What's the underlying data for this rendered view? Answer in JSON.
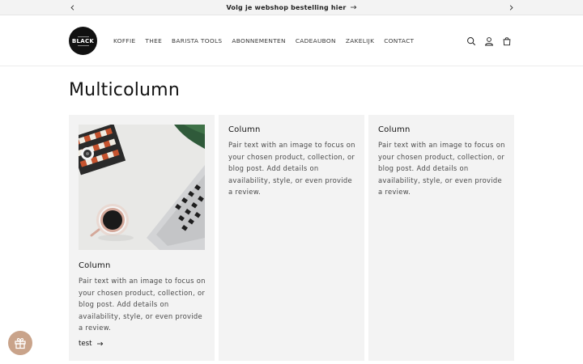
{
  "announcement": {
    "message": "Volg je webshop bestelling hier"
  },
  "header": {
    "logo_text": "BLACK",
    "nav": [
      {
        "label": "KOFFIE"
      },
      {
        "label": "THEE"
      },
      {
        "label": "BARISTA TOOLS"
      },
      {
        "label": "ABONNEMENTEN"
      },
      {
        "label": "CADEAUBON"
      },
      {
        "label": "ZAKELIJK"
      },
      {
        "label": "CONTACT"
      }
    ],
    "icons": [
      "search-icon",
      "account-icon",
      "cart-icon"
    ]
  },
  "main": {
    "title": "Multicolumn",
    "columns": [
      {
        "title": "Column",
        "text": "Pair text with an image to focus on your chosen product, collection, or blog post. Add details on availability, style, or even provide a review.",
        "link": "test",
        "has_image": true
      },
      {
        "title": "Column",
        "text": "Pair text with an image to focus on your chosen product, collection, or blog post. Add details on availability, style, or even provide a review."
      },
      {
        "title": "Column",
        "text": "Pair text with an image to focus on your chosen product, collection, or blog post. Add details on availability, style, or even provide a review."
      }
    ]
  },
  "floating": {
    "icon": "gift-icon",
    "color": "#c9a38a"
  },
  "colors": {
    "card_bg": "#f3f3f3",
    "announce_bg": "#f3f3f3",
    "text": "#121212"
  }
}
